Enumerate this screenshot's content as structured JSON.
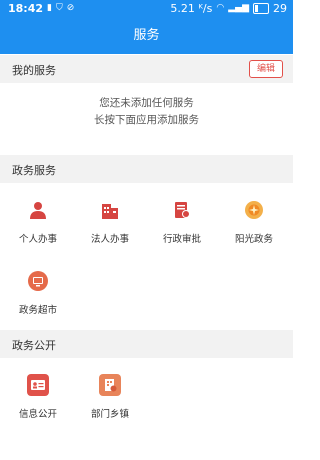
{
  "status_bar": {
    "time": "18:42",
    "speed": "5.21 ᴷ/s",
    "battery": "29",
    "battery_level": 0.29
  },
  "app_bar": {
    "title": "服务"
  },
  "my_services": {
    "title": "我的服务",
    "edit_label": "编辑",
    "empty_line1": "您还未添加任何服务",
    "empty_line2": "长按下面应用添加服务"
  },
  "gov_services": {
    "title": "政务服务",
    "items": [
      {
        "label": "个人办事",
        "icon": "person-icon",
        "color": "#d64541"
      },
      {
        "label": "法人办事",
        "icon": "building-icon",
        "color": "#d64541"
      },
      {
        "label": "行政审批",
        "icon": "document-stamp-icon",
        "color": "#d64541"
      },
      {
        "label": "阳光政务",
        "icon": "sun-icon",
        "color": "#f0a030"
      },
      {
        "label": "政务超市",
        "icon": "computer-icon",
        "color": "#e56a4a"
      }
    ]
  },
  "gov_open": {
    "title": "政务公开",
    "items": [
      {
        "label": "信息公开",
        "icon": "id-card-icon",
        "color": "#e0524a"
      },
      {
        "label": "部门乡镇",
        "icon": "department-icon",
        "color": "#e8845a"
      }
    ]
  },
  "colors": {
    "primary": "#1e8ff0",
    "accent_red": "#e2504a",
    "section_bg": "#f2f2f2"
  }
}
